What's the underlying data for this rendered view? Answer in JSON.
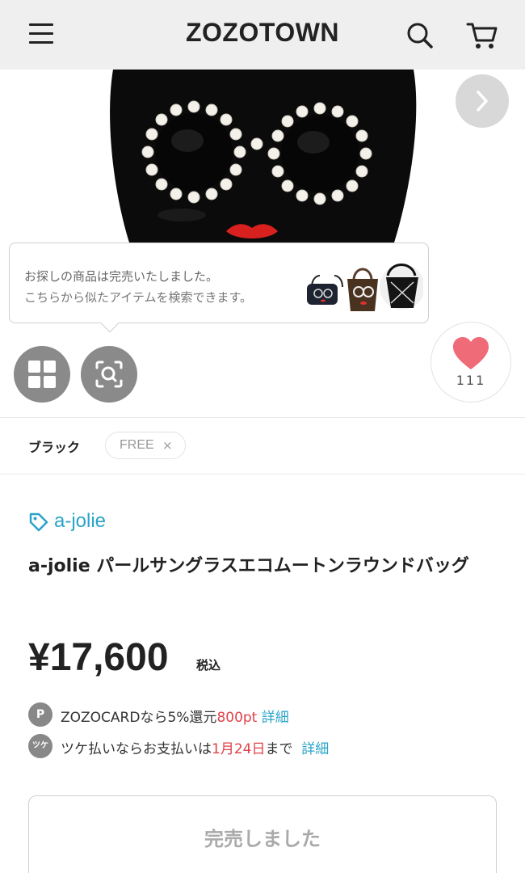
{
  "header": {
    "logo": "ZOZOTOWN",
    "menu_icon": "hamburger-menu-icon",
    "search_icon": "search-icon",
    "cart_icon": "cart-icon"
  },
  "hero": {
    "image": "black-mouton-bag-with-pearl-sunglasses",
    "next_icon": "chevron-right-icon"
  },
  "soldout_tooltip": {
    "line1": "お探しの商品は完売いたしました。",
    "line2": "こちらから似たアイテムを検索できます。",
    "thumbnails": [
      "navy-bag-thumb",
      "brown-bag-thumb",
      "black-bag-thumb"
    ]
  },
  "actions": {
    "grid_icon": "grid-icon",
    "lens_icon": "image-search-icon",
    "favorite_icon": "heart-icon",
    "favorite_count": "111"
  },
  "variant": {
    "color": "ブラック",
    "size": "FREE",
    "size_state": "×"
  },
  "product": {
    "brand": "a-jolie",
    "brand_icon": "tag-icon",
    "title": "a-jolie パールサングラスエコムートンラウンドバッグ",
    "price": "¥17,600",
    "tax_label": "税込"
  },
  "offers": {
    "card": {
      "badge": "P",
      "prefix": "ZOZOCARDなら5%還元",
      "points": "800pt",
      "link": "詳細"
    },
    "tsuke": {
      "badge": "ツケ",
      "prefix": "ツケ払いならお支払いは",
      "date": "1月24日",
      "suffix": "まで",
      "link": "詳細"
    }
  },
  "soldout_button": {
    "label": "完売しました"
  },
  "colors": {
    "accent": "#2aa3c8",
    "highlight": "#e0404a",
    "header_bg": "#efefef",
    "heart": "#f06b78"
  }
}
